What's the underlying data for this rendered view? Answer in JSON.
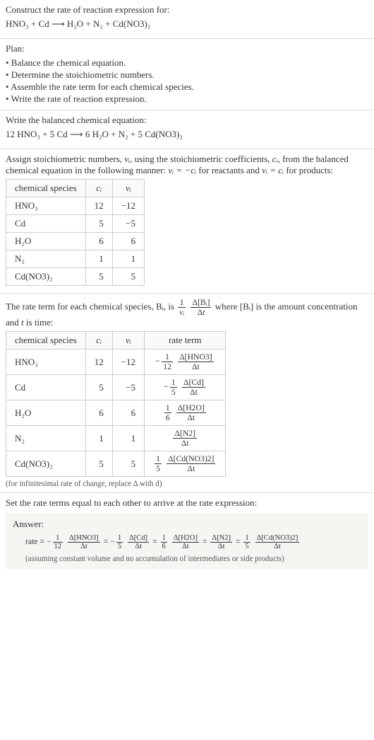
{
  "q1": "Construct the rate of reaction expression for:",
  "eq1": "HNO₃ + Cd ⟶ H₂O + N₂ + Cd(NO3)₂",
  "plan_header": "Plan:",
  "plan_b1": "• Balance the chemical equation.",
  "plan_b2": "• Determine the stoichiometric numbers.",
  "plan_b3": "• Assemble the rate term for each chemical species.",
  "plan_b4": "• Write the rate of reaction expression.",
  "s1": "Write the balanced chemical equation:",
  "eq2": "12 HNO₃ + 5 Cd ⟶ 6 H₂O + N₂ + 5 Cd(NO3)₂",
  "s2a": "Assign stoichiometric numbers, ",
  "s2a_vi": "νᵢ",
  "s2b": ", using the stoichiometric coefficients, ",
  "s2b_ci": "cᵢ",
  "s2c": ", from the balanced chemical equation in the following manner: ",
  "s2c_eq1": "νᵢ = −cᵢ",
  "s2d": " for reactants and ",
  "s2d_eq2": "νᵢ = cᵢ",
  "s2e": " for products:",
  "t1": {
    "h1": "chemical species",
    "h2": "cᵢ",
    "h3": "νᵢ",
    "r1c1": "HNO₃",
    "r1c2": "12",
    "r1c3": "−12",
    "r2c1": "Cd",
    "r2c2": "5",
    "r2c3": "−5",
    "r3c1": "H₂O",
    "r3c2": "6",
    "r3c3": "6",
    "r4c1": "N₂",
    "r4c2": "1",
    "r4c3": "1",
    "r5c1": "Cd(NO3)₂",
    "r5c2": "5",
    "r5c3": "5"
  },
  "s3a": "The rate term for each chemical species, Bᵢ, is ",
  "s3b": " where [Bᵢ] is the amount concentration and ",
  "s3b_t": "t",
  "s3c": " is time:",
  "t2": {
    "h1": "chemical species",
    "h2": "cᵢ",
    "h3": "νᵢ",
    "h4": "rate term",
    "r1c1": "HNO₃",
    "r1c2": "12",
    "r1c3": "−12",
    "r2c1": "Cd",
    "r2c2": "5",
    "r2c3": "−5",
    "r3c1": "H₂O",
    "r3c2": "6",
    "r3c3": "6",
    "r4c1": "N₂",
    "r4c2": "1",
    "r4c3": "1",
    "r5c1": "Cd(NO3)₂",
    "r5c2": "5",
    "r5c3": "5"
  },
  "rt": {
    "r1a": "1",
    "r1b": "12",
    "r1n": "Δ[HNO3]",
    "r1d": "Δt",
    "r2a": "1",
    "r2b": "5",
    "r2n": "Δ[Cd]",
    "r2d": "Δt",
    "r3a": "1",
    "r3b": "6",
    "r3n": "Δ[H2O]",
    "r3d": "Δt",
    "r4n": "Δ[N2]",
    "r4d": "Δt",
    "r5a": "1",
    "r5b": "5",
    "r5n": "Δ[Cd(NO3)2]",
    "r5d": "Δt"
  },
  "note1": "(for infinitesimal rate of change, replace Δ with d)",
  "s4": "Set the rate terms equal to each other to arrive at the rate expression:",
  "ans_label": "Answer:",
  "ans_foot": "(assuming constant volume and no accumulation of intermediates or side products)",
  "chart_data": {
    "type": "table",
    "tables": [
      {
        "title": "stoichiometric numbers",
        "headers": [
          "chemical species",
          "c_i",
          "ν_i"
        ],
        "rows": [
          [
            "HNO3",
            12,
            -12
          ],
          [
            "Cd",
            5,
            -5
          ],
          [
            "H2O",
            6,
            6
          ],
          [
            "N2",
            1,
            1
          ],
          [
            "Cd(NO3)2",
            5,
            5
          ]
        ]
      },
      {
        "title": "rate terms",
        "headers": [
          "chemical species",
          "c_i",
          "ν_i",
          "rate term"
        ],
        "rows": [
          [
            "HNO3",
            12,
            -12,
            "-(1/12) Δ[HNO3]/Δt"
          ],
          [
            "Cd",
            5,
            -5,
            "-(1/5) Δ[Cd]/Δt"
          ],
          [
            "H2O",
            6,
            6,
            "(1/6) Δ[H2O]/Δt"
          ],
          [
            "N2",
            1,
            1,
            "Δ[N2]/Δt"
          ],
          [
            "Cd(NO3)2",
            5,
            5,
            "(1/5) Δ[Cd(NO3)2]/Δt"
          ]
        ]
      }
    ],
    "balanced_equation": "12 HNO3 + 5 Cd -> 6 H2O + N2 + 5 Cd(NO3)2",
    "rate_expression": "rate = -(1/12) Δ[HNO3]/Δt = -(1/5) Δ[Cd]/Δt = (1/6) Δ[H2O]/Δt = Δ[N2]/Δt = (1/5) Δ[Cd(NO3)2]/Δt"
  }
}
